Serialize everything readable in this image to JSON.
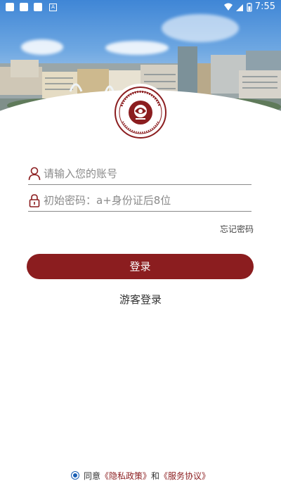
{
  "status_bar": {
    "time": "7:55",
    "notification_icon_letter": "A"
  },
  "login": {
    "username_placeholder": "请输入您的账号",
    "password_placeholder": "初始密码：a+身份证后8位",
    "forgot_password": "忘记密码",
    "login_button": "登录",
    "guest_login": "游客登录"
  },
  "agreement": {
    "prefix": "同意",
    "privacy_policy": "《隐私政策》",
    "conjunction": "和",
    "service_agreement": "《服务协议》",
    "checked": true
  },
  "colors": {
    "brand": "#8b1d1f",
    "radio_accent": "#1a5fb4"
  },
  "icons": {
    "username": "person-icon",
    "password": "lock-icon"
  }
}
